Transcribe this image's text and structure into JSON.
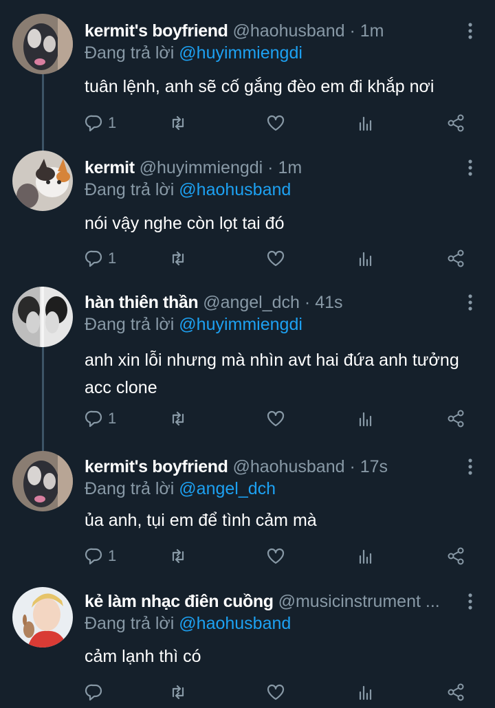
{
  "colors": {
    "background": "#15202b",
    "text_primary": "#ffffff",
    "text_secondary": "#8899a6",
    "mention": "#1da1f2",
    "thread_line": "#3d5466"
  },
  "icons": {
    "reply": "reply-icon",
    "retweet": "retweet-icon",
    "like": "heart-icon",
    "analytics": "analytics-icon",
    "share": "share-icon",
    "more": "more-icon"
  },
  "tweets": [
    {
      "name": "kermit's boyfriend",
      "handle": "@haohusband",
      "separator": "·",
      "time": "1m",
      "reply_prefix": "Đang trả lời ",
      "reply_mention": "@huyimmiengdi",
      "text": "tuân lệnh, anh sẽ cố gắng đèo em đi khắp nơi",
      "reply_count": "1"
    },
    {
      "name": "kermit",
      "handle": "@huyimmiengdi",
      "separator": "·",
      "time": "1m",
      "reply_prefix": "Đang trả lời ",
      "reply_mention": "@haohusband",
      "text": "nói vậy nghe còn lọt tai đó",
      "reply_count": "1"
    },
    {
      "name": "hàn thiên thần",
      "handle": "@angel_dch",
      "separator": "·",
      "time": "41s",
      "reply_prefix": "Đang trả lời ",
      "reply_mention": "@huyimmiengdi",
      "text_line1": "anh xin lỗi nhưng mà nhìn avt hai đứa anh tưởng",
      "text_line2": "acc clone",
      "reply_count": "1"
    },
    {
      "name": "kermit's boyfriend",
      "handle": "@haohusband",
      "separator": "·",
      "time": "17s",
      "reply_prefix": "Đang trả lời ",
      "reply_mention": "@angel_dch",
      "text": "ủa anh, tụi em để tình cảm mà",
      "reply_count": "1"
    },
    {
      "name": "kẻ làm nhạc điên cuồng",
      "handle": "@musicinstrument ...",
      "reply_prefix": "Đang trả lời ",
      "reply_mention": "@haohusband",
      "text": "cảm lạnh thì có",
      "reply_count": ""
    }
  ]
}
